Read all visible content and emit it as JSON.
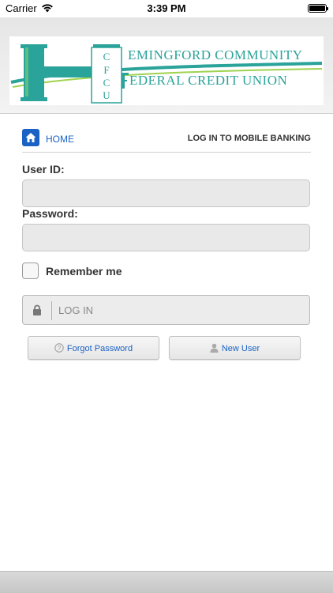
{
  "status_bar": {
    "carrier": "Carrier",
    "time": "3:39 PM",
    "battery_level": 1.0
  },
  "header": {
    "logo": {
      "line1": "EMINGFORD COMMUNITY",
      "line2": "EDERAL CREDIT UNION",
      "monogram": "CFCU",
      "color": "#2aa39a"
    }
  },
  "nav": {
    "home_label": "HOME",
    "home_icon": "home-icon",
    "title": "LOG IN TO MOBILE BANKING"
  },
  "form": {
    "user_id_label": "User ID:",
    "user_id_value": "",
    "password_label": "Password:",
    "password_value": "",
    "remember_label": "Remember me",
    "remember_checked": false,
    "login_label": "LOG IN",
    "login_icon": "lock-icon"
  },
  "links": {
    "forgot_password": "Forgot Password",
    "forgot_icon": "question-circle-icon",
    "new_user": "New User",
    "new_user_icon": "user-icon"
  },
  "colors": {
    "accent": "#1a62c4",
    "logo": "#2aa39a"
  }
}
